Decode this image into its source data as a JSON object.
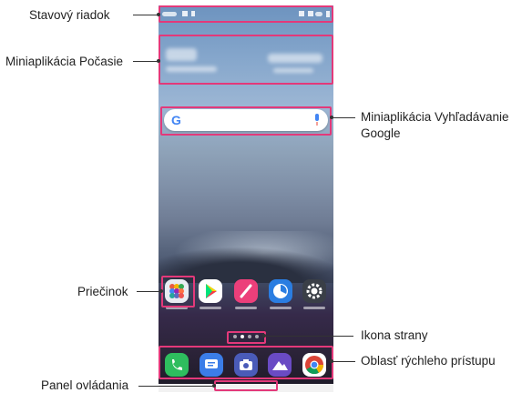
{
  "callouts": {
    "status_bar": "Stavový riadok",
    "weather_widget": "Miniaplikácia Počasie",
    "search_widget_line1": "Miniaplikácia Vyhľadávanie",
    "search_widget_line2": "Google",
    "folder": "Priečinok",
    "page_icon": "Ikona strany",
    "quick_access": "Oblasť rýchleho prístupu",
    "control_panel": "Panel ovládania"
  },
  "search_bar": {
    "logo_letter": "G"
  },
  "colors": {
    "callout_border": "#e3397a"
  },
  "icons": {
    "home_apps": [
      "folder-icon",
      "play-store-icon",
      "pen-icon",
      "clock-icon",
      "settings-icon"
    ],
    "dock_apps": [
      "phone-icon",
      "messages-icon",
      "camera-icon",
      "gallery-icon",
      "chrome-icon"
    ]
  }
}
